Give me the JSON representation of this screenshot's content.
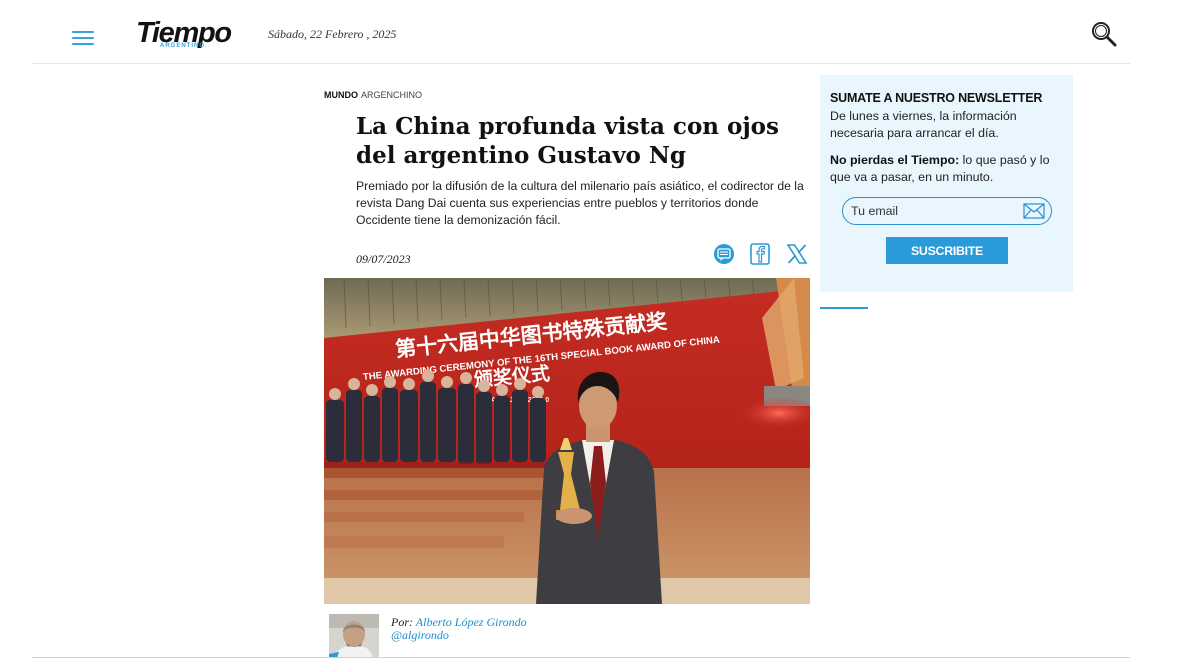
{
  "header": {
    "logo_main": "Tiempo",
    "logo_sub": "ARGENTINO",
    "date": "Sábado, 22 Febrero , 2025"
  },
  "article": {
    "section": "MUNDO",
    "tag": "ARGENCHINO",
    "headline": "La China profunda vista con ojos del argentino Gustavo Ng",
    "summary": "Premiado por la difusión de la cultura del milenario país asiático, el codirector de la revista Dang Dai cuenta sus experiencias entre pueblos y territorios donde Occidente tiene la demonización fácil.",
    "date": "09/07/2023",
    "photo": {
      "banner_line1": "第十六届中华图书特殊贡献奖",
      "banner_line2": "THE AWARDING CEREMONY OF THE 16TH SPECIAL BOOK AWARD OF CHINA",
      "banner_line3": "颁奖仪式",
      "banner_small": "INA    BEIJING    2023.0"
    },
    "byline_prefix": "Por:",
    "author": "Alberto López Girondo",
    "handle": "@algirondo"
  },
  "share": {
    "icons": [
      "comments-icon",
      "facebook-icon",
      "x-icon"
    ]
  },
  "newsletter": {
    "title": "SUMATE A NUESTRO NEWSLETTER",
    "text1": "De lunes a viernes, la información necesaria para arrancar el día.",
    "text2_bold": "No pierdas el Tiempo:",
    "text2_rest": " lo que pasó y lo que va a pasar, en un minuto.",
    "email_placeholder": "Tu email",
    "button_label": "SUSCRIBITE"
  },
  "colors": {
    "accent": "#2a9ad8",
    "newsletter_bg": "#eaf6fd",
    "banner_red": "#c4241c"
  }
}
